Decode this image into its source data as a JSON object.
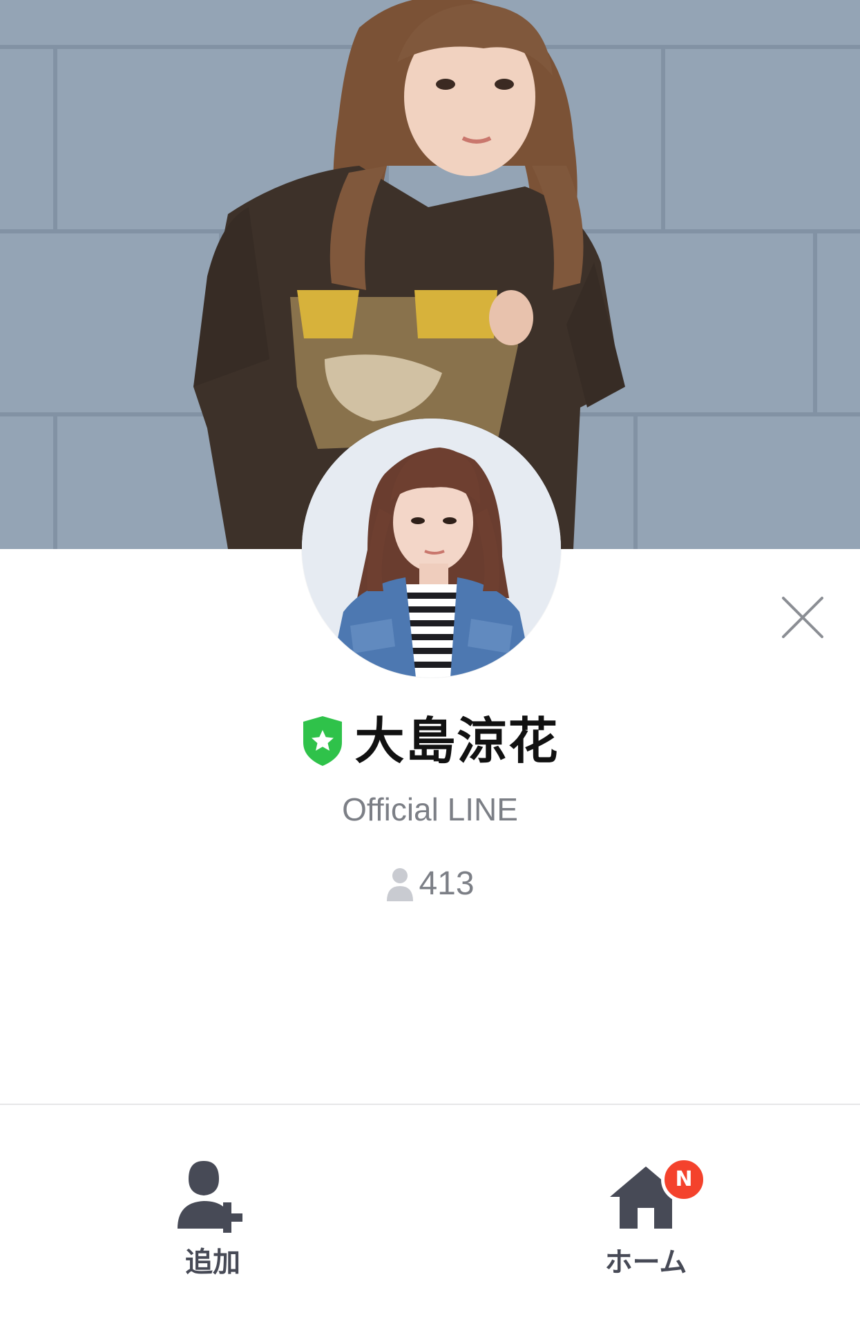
{
  "profile": {
    "name": "大島涼花",
    "subtitle": "Official LINE",
    "friend_count": "413",
    "badge_icon": "official-shield-star-icon"
  },
  "cover_photo": {
    "icon": "cover-photo"
  },
  "avatar": {
    "icon": "profile-avatar"
  },
  "close": {
    "icon": "close-icon"
  },
  "actions": {
    "add": {
      "label": "追加",
      "icon": "add-friend-icon"
    },
    "home": {
      "label": "ホーム",
      "icon": "home-icon",
      "badge": "N"
    }
  },
  "colors": {
    "official_green": "#2fc24a",
    "text_primary": "#111111",
    "text_secondary": "#7c7f86",
    "icon_dark": "#474a56",
    "notification_red": "#f4422c"
  }
}
